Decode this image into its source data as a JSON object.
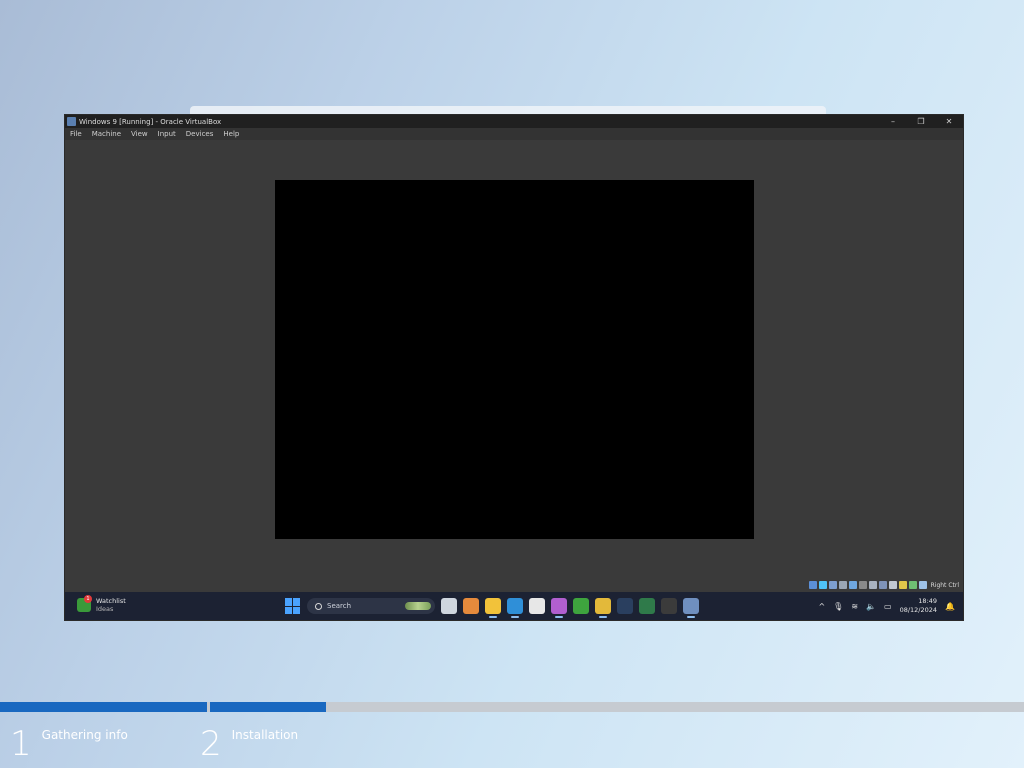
{
  "window": {
    "title": "Windows 9  [Running] - Oracle VirtualBox",
    "controls": [
      "–",
      "❐",
      "✕"
    ]
  },
  "menu": [
    "File",
    "Machine",
    "View",
    "Input",
    "Devices",
    "Help"
  ],
  "statusbar": {
    "host_key": "Right Ctrl",
    "icon_colors": [
      "#5b8fd6",
      "#4fc3f7",
      "#7e9fd0",
      "#9aa6b5",
      "#6fa7e0",
      "#8a8a8a",
      "#a9b2bf",
      "#7f93b8",
      "#c2c8d0",
      "#e0c64a",
      "#6fbf73",
      "#9ec2e8"
    ]
  },
  "taskbar": {
    "weather_title": "Watchlist",
    "weather_sub": "Ideas",
    "weather_badge": "1",
    "search_placeholder": "Search",
    "apps": [
      {
        "name": "task-view",
        "color": "#cfd6df"
      },
      {
        "name": "copilot",
        "color": "#e58a3c"
      },
      {
        "name": "file-explorer",
        "color": "#f2c23a"
      },
      {
        "name": "edge",
        "color": "#2f8fd8"
      },
      {
        "name": "store",
        "color": "#e7e7e7"
      },
      {
        "name": "photos",
        "color": "#b15fd0"
      },
      {
        "name": "xbox",
        "color": "#3ea43e"
      },
      {
        "name": "chrome",
        "color": "#e3b93a"
      },
      {
        "name": "steam",
        "color": "#2a3f5f"
      },
      {
        "name": "vivaldi",
        "color": "#2f7a4a"
      },
      {
        "name": "security",
        "color": "#3b3b3b"
      },
      {
        "name": "virtualbox",
        "color": "#6f8fbf"
      }
    ],
    "time": "18:49",
    "date": "08/12/2024"
  },
  "setup": {
    "progress_fraction": 0.318,
    "steps": [
      {
        "num": "1",
        "label": "Gathering info"
      },
      {
        "num": "2",
        "label": "Installation"
      }
    ]
  }
}
